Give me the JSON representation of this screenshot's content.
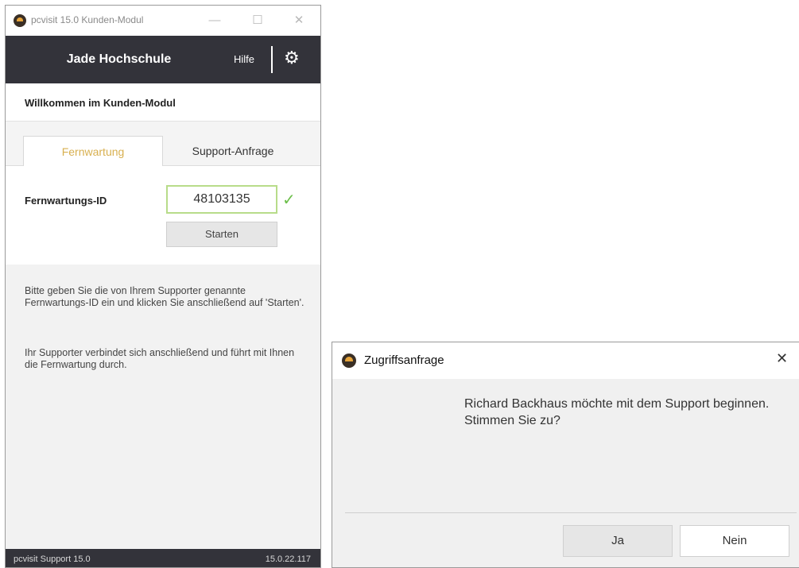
{
  "main_window": {
    "title": "pcvisit 15.0 Kunden-Modul",
    "controls": {
      "minimize": "—",
      "maximize": "☐",
      "close": "✕"
    },
    "header": {
      "org_name": "Jade Hochschule",
      "help_label": "Hilfe",
      "settings_icon": "gear-icon"
    },
    "welcome": "Willkommen im Kunden-Modul",
    "tabs": [
      {
        "label": "Fernwartung",
        "active": true
      },
      {
        "label": "Support-Anfrage",
        "active": false
      }
    ],
    "form": {
      "id_label": "Fernwartungs-ID",
      "id_value": "48103135",
      "valid_icon": "check-icon",
      "start_label": "Starten"
    },
    "info": [
      "Bitte geben Sie die von Ihrem Supporter genannte Fernwartungs-ID ein und klicken Sie anschließend auf 'Starten'.",
      "Ihr Supporter verbindet sich anschließend und führt mit Ihnen die Fernwartung durch."
    ],
    "footer": {
      "left": "pcvisit Support 15.0",
      "right": "15.0.22.117"
    },
    "colors": {
      "header_bg": "#33333a",
      "active_tab_text": "#d8b050",
      "input_border": "#b8dc8a",
      "check": "#6cbf4a",
      "logo_accent": "#e8a53b"
    }
  },
  "dialog": {
    "title": "Zugriffsanfrage",
    "close": "✕",
    "message": "Richard Backhaus möchte mit dem Support beginnen. Stimmen Sie zu?",
    "yes_label": "Ja",
    "no_label": "Nein"
  }
}
